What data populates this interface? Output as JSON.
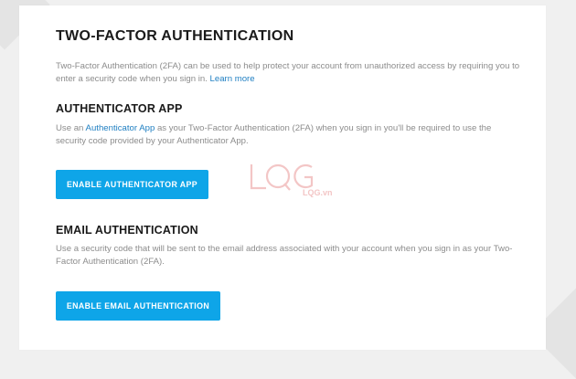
{
  "title": "TWO-FACTOR AUTHENTICATION",
  "intro": {
    "text": "Two-Factor Authentication (2FA) can be used to help protect your account from unauthorized access by requiring you to enter a security code when you sign in.",
    "learn_more": "Learn more"
  },
  "authenticator": {
    "heading": "AUTHENTICATOR APP",
    "desc_before": "Use an ",
    "desc_link": "Authenticator App",
    "desc_after": " as your Two-Factor Authentication (2FA) when you sign in you'll be required to use the security code provided by your Authenticator App.",
    "button": "ENABLE AUTHENTICATOR APP"
  },
  "email": {
    "heading": "EMAIL AUTHENTICATION",
    "desc": "Use a security code that will be sent to the email address associated with your account when you sign in as your Two-Factor Authentication (2FA).",
    "button": "ENABLE EMAIL AUTHENTICATION"
  },
  "watermark": "LQG.vn",
  "colors": {
    "accent": "#0ea5e8",
    "link": "#1f7fc2",
    "watermark": "#f3c6c6"
  }
}
